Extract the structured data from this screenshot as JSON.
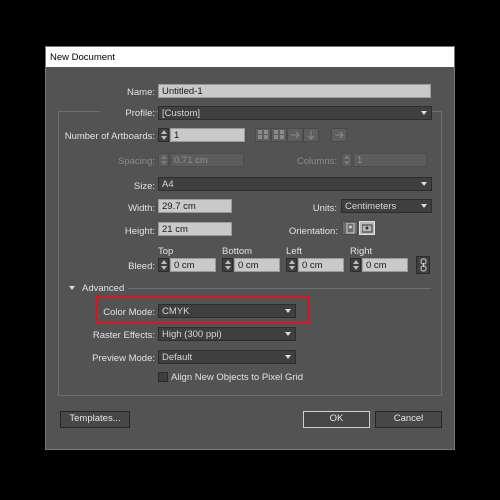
{
  "dialog": {
    "title": "New Document"
  },
  "name": {
    "label": "Name:",
    "value": "Untitled-1"
  },
  "profile": {
    "label": "Profile:",
    "value": "[Custom]"
  },
  "artboards": {
    "label": "Number of Artboards:",
    "value": "1"
  },
  "spacing": {
    "label": "Spacing:",
    "value": "0.71 cm"
  },
  "columns": {
    "label": "Columns:",
    "value": "1"
  },
  "size": {
    "label": "Size:",
    "value": "A4"
  },
  "width": {
    "label": "Width:",
    "value": "29.7 cm"
  },
  "units": {
    "label": "Units:",
    "value": "Centimeters"
  },
  "height": {
    "label": "Height:",
    "value": "21 cm"
  },
  "orientation": {
    "label": "Orientation:",
    "selected": "landscape"
  },
  "bleed": {
    "label": "Bleed:",
    "top_label": "Top",
    "top": "0 cm",
    "bottom_label": "Bottom",
    "bottom": "0 cm",
    "left_label": "Left",
    "left": "0 cm",
    "right_label": "Right",
    "right": "0 cm"
  },
  "advanced": {
    "label": "Advanced",
    "color_mode": {
      "label": "Color Mode:",
      "value": "CMYK"
    },
    "raster_effects": {
      "label": "Raster Effects:",
      "value": "High (300 ppi)"
    },
    "preview_mode": {
      "label": "Preview Mode:",
      "value": "Default"
    },
    "align_pixel_grid": {
      "label": "Align New Objects to Pixel Grid",
      "checked": false
    }
  },
  "buttons": {
    "templates": "Templates...",
    "ok": "OK",
    "cancel": "Cancel"
  },
  "colors": {
    "dialog_bg": "#535353",
    "highlight": "#e1121f"
  }
}
